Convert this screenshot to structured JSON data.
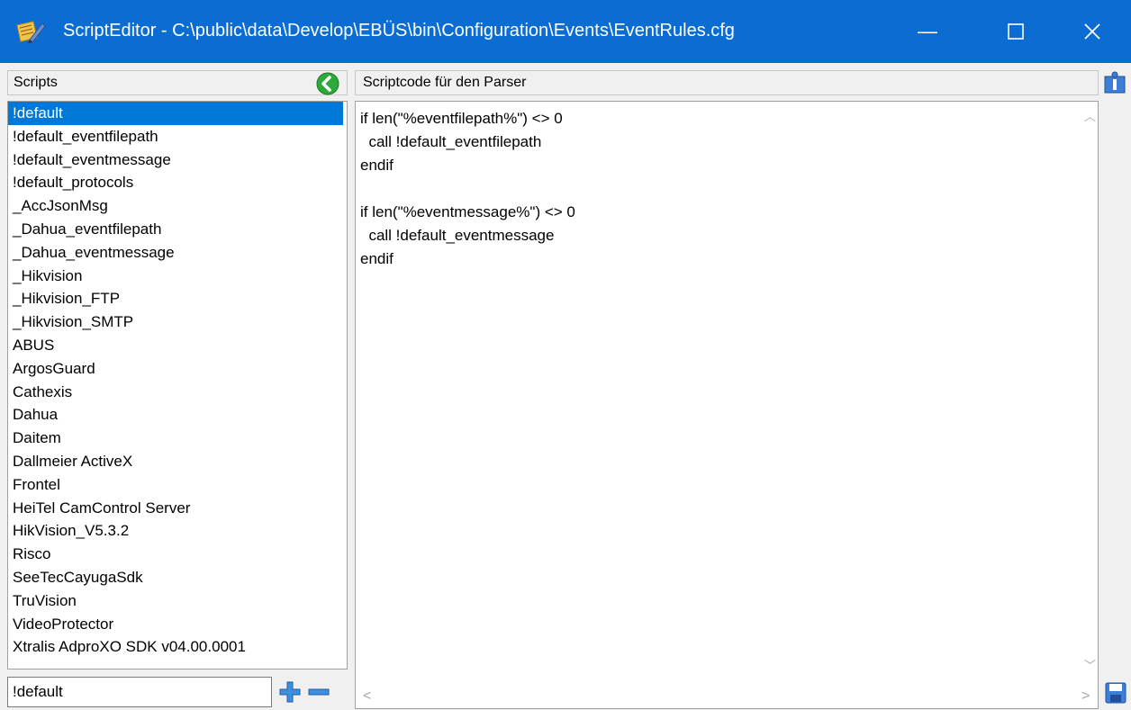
{
  "window": {
    "title": "ScriptEditor - C:\\public\\data\\Develop\\EBÜS\\bin\\Configuration\\Events\\EventRules.cfg",
    "minimize_glyph": "—",
    "maximize_glyph": "☐",
    "close_glyph": "✕"
  },
  "scripts_panel": {
    "header": "Scripts",
    "items": [
      "!default",
      "!default_eventfilepath",
      "!default_eventmessage",
      "!default_protocols",
      "_AccJsonMsg",
      "_Dahua_eventfilepath",
      "_Dahua_eventmessage",
      "_Hikvision",
      "_Hikvision_FTP",
      "_Hikvision_SMTP",
      "ABUS",
      "ArgosGuard",
      "Cathexis",
      "Dahua",
      "Daitem",
      "Dallmeier ActiveX",
      "Frontel",
      "HeiTel CamControl Server",
      "HikVision_V5.3.2",
      "Risco",
      "SeeTecCayugaSdk",
      "TruVision",
      "VideoProtector",
      "Xtralis AdproXO SDK v04.00.0001"
    ],
    "selected_index": 0,
    "name_input_value": "!default"
  },
  "code_panel": {
    "header": "Scriptcode für den Parser",
    "code": "if len(\"%eventfilepath%\") <> 0\n  call !default_eventfilepath\nendif\n\nif len(\"%eventmessage%\") <> 0\n  call !default_eventmessage\nendif"
  },
  "colors": {
    "titlebar": "#0b6cd1",
    "selection": "#0078d7",
    "back_button_green": "#2eaa3a",
    "plus_minus_blue": "#3d8fe0"
  },
  "icons": {
    "app": "script-pen-icon",
    "back": "green-arrow-left-icon",
    "add": "plus-icon",
    "remove": "minus-icon",
    "info": "info-icon",
    "save": "floppy-disk-icon"
  }
}
